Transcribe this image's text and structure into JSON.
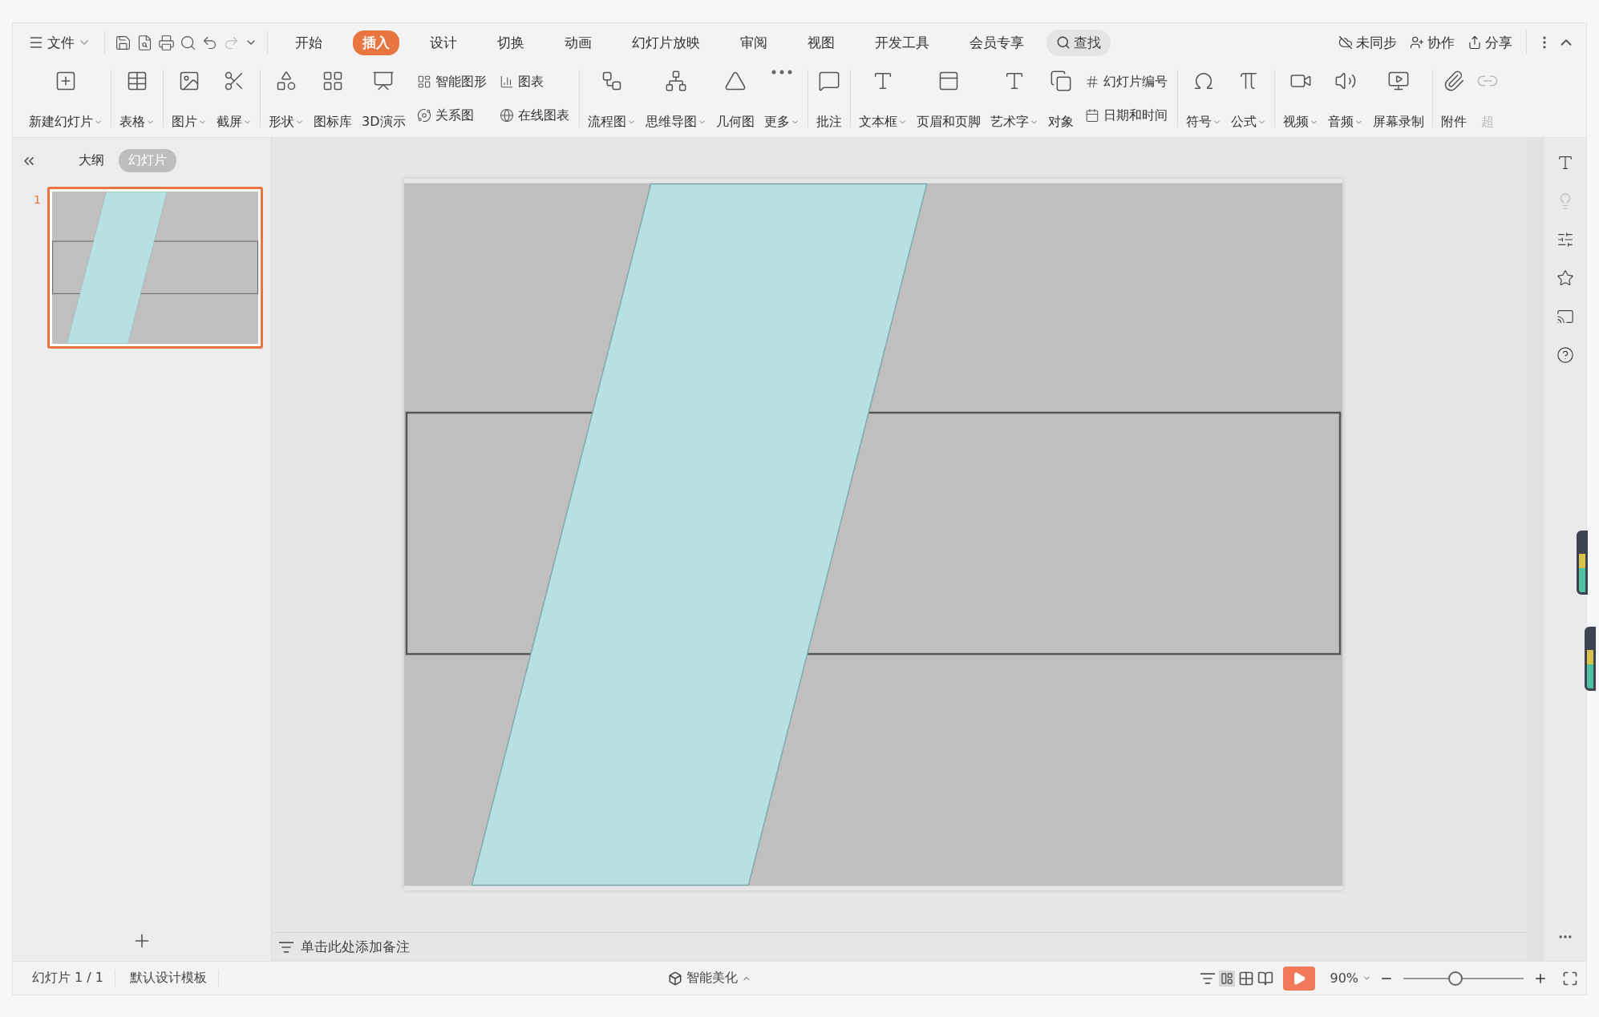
{
  "menu": {
    "label": "文件"
  },
  "tabs": [
    {
      "label": "开始",
      "selected": false
    },
    {
      "label": "插入",
      "selected": true
    },
    {
      "label": "设计",
      "selected": false
    },
    {
      "label": "切换",
      "selected": false
    },
    {
      "label": "动画",
      "selected": false
    },
    {
      "label": "幻灯片放映",
      "selected": false
    },
    {
      "label": "审阅",
      "selected": false
    },
    {
      "label": "视图",
      "selected": false
    },
    {
      "label": "开发工具",
      "selected": false
    },
    {
      "label": "会员专享",
      "selected": false
    }
  ],
  "search": {
    "label": "查找"
  },
  "account_actions": [
    {
      "label": "未同步"
    },
    {
      "label": "协作"
    },
    {
      "label": "分享"
    }
  ],
  "ribbon": [
    {
      "kind": "big",
      "label": "新建幻灯片",
      "dropdown": true
    },
    {
      "kind": "separator"
    },
    {
      "kind": "big",
      "label": "表格",
      "dropdown": true
    },
    {
      "kind": "separator"
    },
    {
      "kind": "big",
      "label": "图片",
      "dropdown": true
    },
    {
      "kind": "big",
      "label": "截屏",
      "dropdown": true
    },
    {
      "kind": "separator"
    },
    {
      "kind": "big",
      "label": "形状",
      "dropdown": true
    },
    {
      "kind": "big",
      "label": "图标库",
      "dropdown": false
    },
    {
      "kind": "big",
      "label": "3D演示",
      "dropdown": false
    },
    {
      "kind": "stack",
      "items": [
        {
          "label": "智能图形"
        },
        {
          "label": "关系图"
        }
      ]
    },
    {
      "kind": "stack",
      "items": [
        {
          "label": "图表"
        },
        {
          "label": "在线图表"
        }
      ]
    },
    {
      "kind": "separator"
    },
    {
      "kind": "big",
      "label": "流程图",
      "dropdown": true
    },
    {
      "kind": "big",
      "label": "思维导图",
      "dropdown": true
    },
    {
      "kind": "big",
      "label": "几何图",
      "dropdown": false
    },
    {
      "kind": "big",
      "label": "更多",
      "dropdown": true
    },
    {
      "kind": "separator"
    },
    {
      "kind": "big",
      "label": "批注",
      "dropdown": false
    },
    {
      "kind": "separator"
    },
    {
      "kind": "big",
      "label": "文本框",
      "dropdown": true
    },
    {
      "kind": "big",
      "label": "页眉和页脚",
      "dropdown": false
    },
    {
      "kind": "big",
      "label": "艺术字",
      "dropdown": true
    },
    {
      "kind": "big",
      "label": "对象",
      "dropdown": false
    },
    {
      "kind": "stack",
      "items": [
        {
          "label": "幻灯片编号"
        },
        {
          "label": "日期和时间"
        }
      ]
    },
    {
      "kind": "separator"
    },
    {
      "kind": "big",
      "label": "符号",
      "dropdown": true
    },
    {
      "kind": "big",
      "label": "公式",
      "dropdown": true
    },
    {
      "kind": "separator"
    },
    {
      "kind": "big",
      "label": "视频",
      "dropdown": true
    },
    {
      "kind": "big",
      "label": "音频",
      "dropdown": true
    },
    {
      "kind": "big",
      "label": "屏幕录制",
      "dropdown": false
    },
    {
      "kind": "separator"
    },
    {
      "kind": "big",
      "label": "附件",
      "dropdown": false
    },
    {
      "kind": "cut",
      "label": "超"
    }
  ],
  "panel_tabs": [
    {
      "label": "大纲",
      "selected": false
    },
    {
      "label": "幻灯片",
      "selected": true
    }
  ],
  "slides": [
    {
      "number": "1",
      "selected": true
    }
  ],
  "notes": {
    "placeholder": "单击此处添加备注"
  },
  "status_bar": {
    "slide_counter": "幻灯片 1 / 1",
    "template": "默认设计模板",
    "beautify": "智能美化",
    "zoom": "90%",
    "zoom_slider": {
      "level": 0.43
    }
  }
}
